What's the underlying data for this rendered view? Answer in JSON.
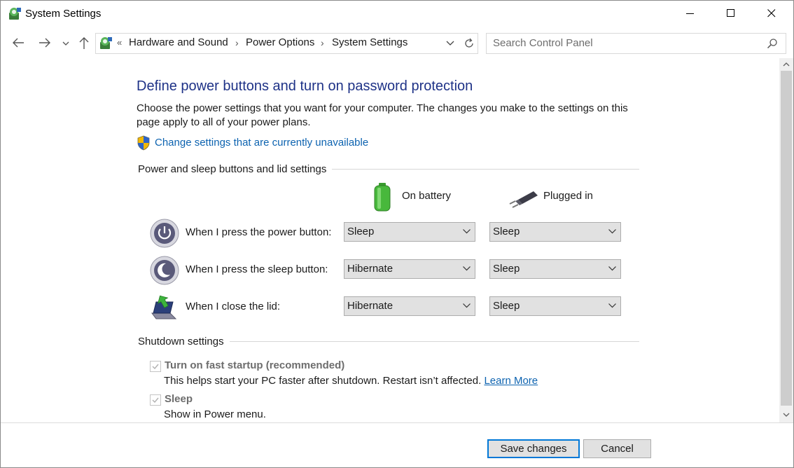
{
  "window": {
    "title": "System Settings",
    "icon": "control-panel-icon"
  },
  "address": {
    "overflow": "«",
    "crumbs": [
      "Hardware and Sound",
      "Power Options",
      "System Settings"
    ],
    "separator": "›"
  },
  "search": {
    "placeholder": "Search Control Panel"
  },
  "page": {
    "title": "Define power buttons and turn on password protection",
    "description": "Choose the power settings that you want for your computer. The changes you make to the settings on this page apply to all of your power plans.",
    "change_link": "Change settings that are currently unavailable"
  },
  "power_group": {
    "label": "Power and sleep buttons and lid settings",
    "columns": {
      "battery": "On battery",
      "plugged": "Plugged in"
    },
    "rows": [
      {
        "label": "When I press the power button:",
        "icon": "power-button-icon",
        "battery": "Sleep",
        "plugged": "Sleep"
      },
      {
        "label": "When I press the sleep button:",
        "icon": "sleep-button-icon",
        "battery": "Hibernate",
        "plugged": "Sleep"
      },
      {
        "label": "When I close the lid:",
        "icon": "laptop-lid-icon",
        "battery": "Hibernate",
        "plugged": "Sleep"
      }
    ]
  },
  "shutdown_group": {
    "label": "Shutdown settings",
    "items": [
      {
        "label": "Turn on fast startup (recommended)",
        "checked": true,
        "desc": "This helps start your PC faster after shutdown. Restart isn’t affected.",
        "link": "Learn More"
      },
      {
        "label": "Sleep",
        "checked": true,
        "desc": "Show in Power menu."
      }
    ]
  },
  "footer": {
    "save": "Save changes",
    "cancel": "Cancel"
  },
  "colors": {
    "title_blue": "#1e3287",
    "link_blue": "#0d63b0",
    "accent": "#0078d7"
  }
}
